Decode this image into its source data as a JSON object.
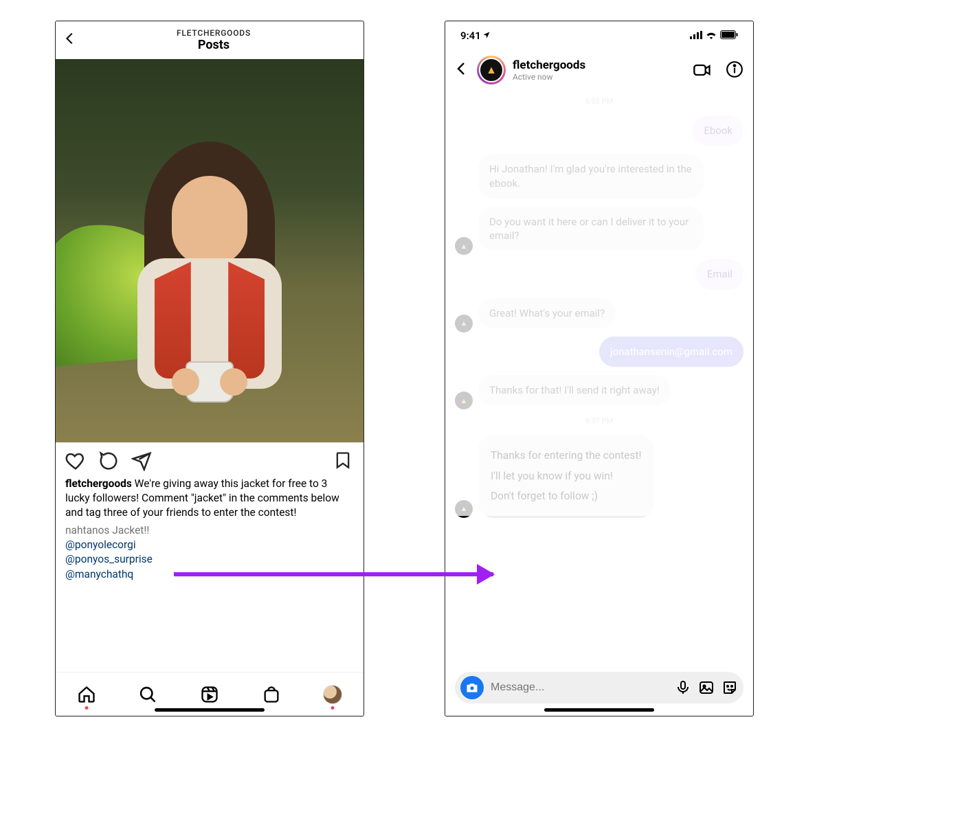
{
  "left": {
    "header": {
      "brand": "FLETCHERGOODS",
      "title": "Posts"
    },
    "caption_user": "fletchergoods",
    "caption_text": " We're giving away this jacket for free to 3 lucky followers! Comment \"jacket\" in the comments below and tag three of your friends to enter the contest!",
    "comment_user": "nahtanos",
    "comment_text": " Jacket!!",
    "mentions": [
      "@ponyolecorgi",
      "@ponyos_surprise",
      "@manychathq"
    ]
  },
  "right": {
    "status_time": "9:41",
    "chat_user": "fletchergoods",
    "chat_status": "Active now",
    "ts1": "6:02 PM",
    "m1": "Ebook",
    "m2": "Hi Jonathan! I'm glad you're interested in the ebook.",
    "m3": "Do you want it here or can I deliver it to your email?",
    "m4": "Email",
    "m5": "Great! What's your email?",
    "m6": "jonathansenin@gmail.com",
    "m7": "Thanks for that! I'll send it right away!",
    "ts2": "6:37 PM",
    "big1": "Thanks for entering the contest!",
    "big2": "I'll let you know if you win!",
    "big3": "Don't forget to follow ;)",
    "composer_placeholder": "Message..."
  }
}
